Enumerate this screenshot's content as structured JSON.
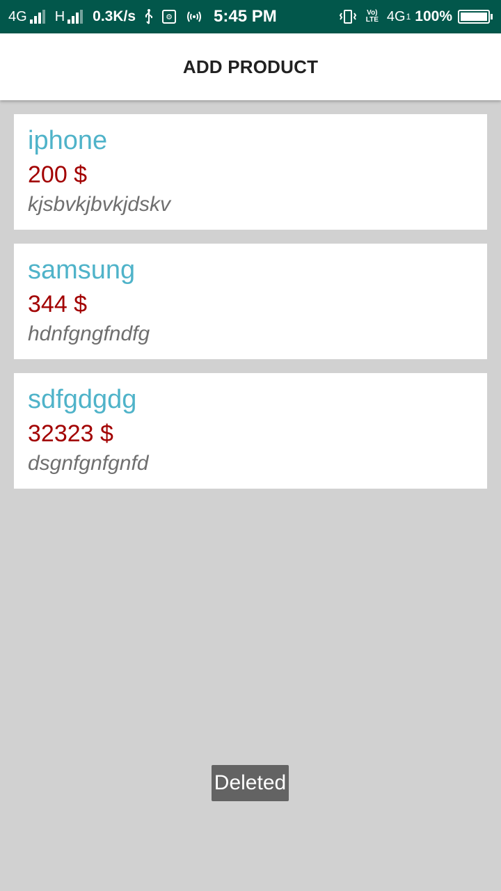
{
  "status_bar": {
    "network_1": "4G",
    "network_2": "H",
    "speed": "0.3K/s",
    "time": "5:45 PM",
    "volte_top": "Vo)",
    "volte_bottom": "LTE",
    "network_3": "4G",
    "sim_index": "1",
    "battery": "100%",
    "battery_level": 1.0,
    "background_color": "#02574b"
  },
  "app_bar": {
    "title": "ADD PRODUCT"
  },
  "products": [
    {
      "name": "iphone",
      "price": "200 $",
      "description": "kjsbvkjbvkjdskv"
    },
    {
      "name": "samsung",
      "price": "344 $",
      "description": "hdnfgngfndfg"
    },
    {
      "name": "sdfgdgdg",
      "price": "32323 $",
      "description": "dsgnfgnfgnfd"
    }
  ],
  "toast": {
    "message": "Deleted"
  },
  "colors": {
    "name": "#4fb3c9",
    "price": "#a20000",
    "description": "#6f6f6f",
    "background": "#d1d1d1"
  }
}
